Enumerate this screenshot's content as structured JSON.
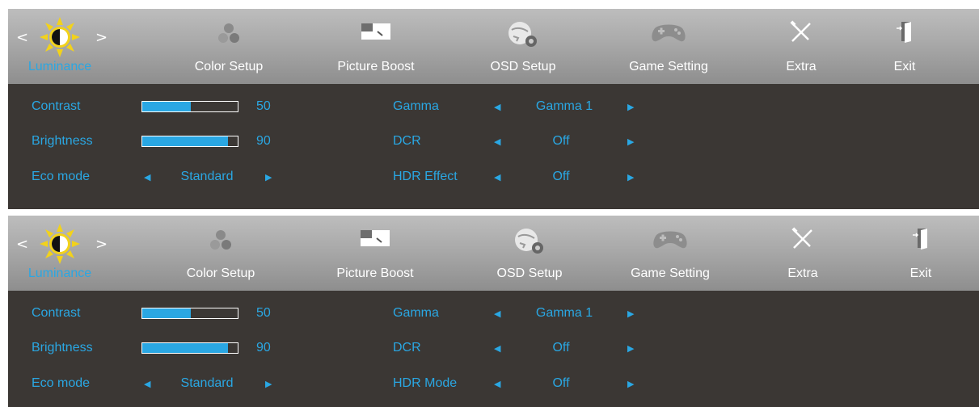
{
  "panels": [
    {
      "tabs": [
        {
          "label": "Luminance",
          "icon": "sun-contrast-icon",
          "active": true
        },
        {
          "label": "Color Setup",
          "icon": "color-dots-icon"
        },
        {
          "label": "Picture Boost",
          "icon": "picture-boost-icon"
        },
        {
          "label": "OSD Setup",
          "icon": "osd-globe-gear-icon"
        },
        {
          "label": "Game Setting",
          "icon": "gamepad-icon"
        },
        {
          "label": "Extra",
          "icon": "tools-icon"
        },
        {
          "label": "Exit",
          "icon": "exit-door-icon"
        }
      ],
      "left": {
        "contrast": {
          "label": "Contrast",
          "value": "50",
          "level": 0.5
        },
        "brightness": {
          "label": "Brightness",
          "value": "90",
          "level": 0.9
        },
        "eco": {
          "label": "Eco mode",
          "value": "Standard"
        }
      },
      "right": {
        "gamma": {
          "label": "Gamma",
          "value": "Gamma 1"
        },
        "dcr": {
          "label": "DCR",
          "value": "Off"
        },
        "hdr": {
          "label": "HDR Effect",
          "value": "Off"
        }
      }
    },
    {
      "tabs": [
        {
          "label": "Luminance",
          "icon": "sun-contrast-icon",
          "active": true
        },
        {
          "label": "Color Setup",
          "icon": "color-dots-icon"
        },
        {
          "label": "Picture Boost",
          "icon": "picture-boost-icon"
        },
        {
          "label": "OSD Setup",
          "icon": "osd-globe-gear-icon"
        },
        {
          "label": "Game Setting",
          "icon": "gamepad-icon"
        },
        {
          "label": "Extra",
          "icon": "tools-icon"
        },
        {
          "label": "Exit",
          "icon": "exit-door-icon"
        }
      ],
      "left": {
        "contrast": {
          "label": "Contrast",
          "value": "50",
          "level": 0.5
        },
        "brightness": {
          "label": "Brightness",
          "value": "90",
          "level": 0.9
        },
        "eco": {
          "label": "Eco mode",
          "value": "Standard"
        }
      },
      "right": {
        "gamma": {
          "label": "Gamma",
          "value": "Gamma 1"
        },
        "dcr": {
          "label": "DCR",
          "value": "Off"
        },
        "hdr": {
          "label": "HDR Mode",
          "value": "Off"
        }
      }
    }
  ],
  "colors": {
    "accent": "#2aa7e3",
    "content_bg": "#3b3734",
    "tab_text": "#ffffff",
    "sun": "#f2d21b"
  }
}
